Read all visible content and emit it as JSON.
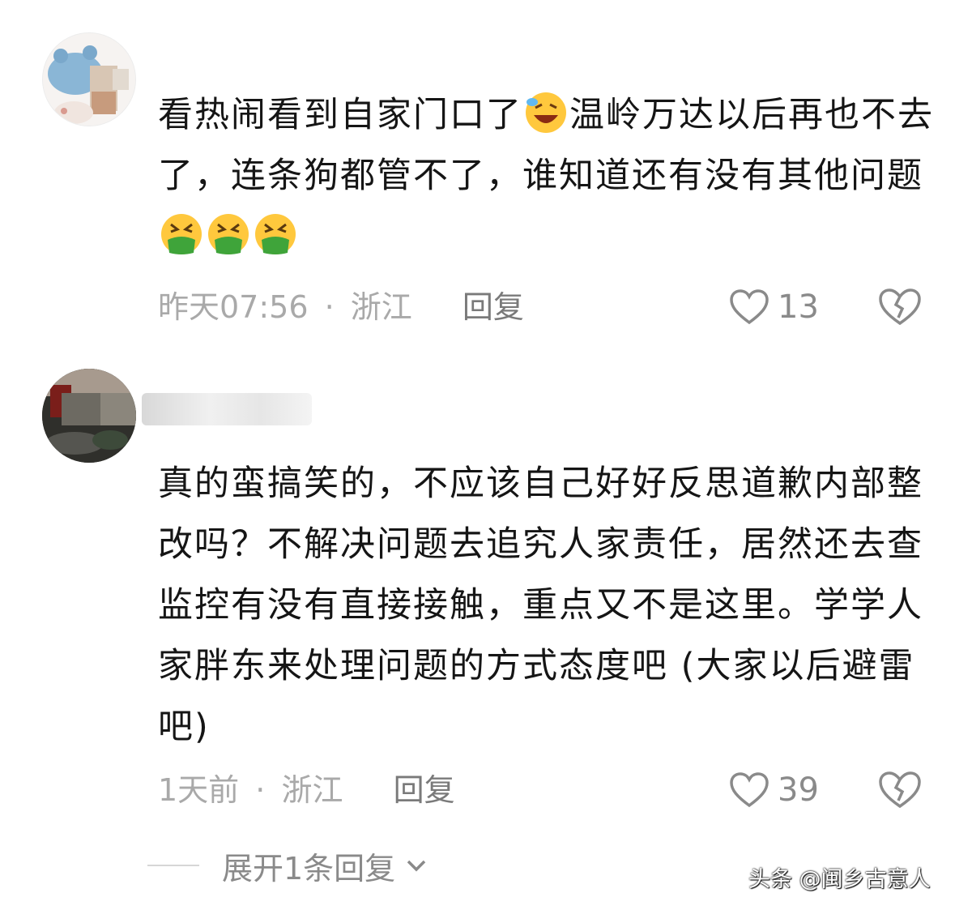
{
  "comments": [
    {
      "text_before": "看热闹看到自家门口了",
      "text_after": "温岭万达以后再也不去了，连条狗都管不了，谁知道还有没有其他问题",
      "emojis": [
        "grin-sweat-emoji",
        "nauseated-emoji",
        "nauseated-emoji",
        "nauseated-emoji"
      ],
      "time": "昨天07:56",
      "separator": "·",
      "location": "浙江",
      "reply_label": "回复",
      "like_count": "13"
    },
    {
      "text": "真的蛮搞笑的，不应该自己好好反思道歉内部整改吗？不解决问题去追究人家责任，居然还去查监控有没有直接接触，重点又不是这里。学学人家胖东来处理问题的方式态度吧 (大家以后避雷吧)",
      "time": "1天前",
      "separator": "·",
      "location": "浙江",
      "reply_label": "回复",
      "like_count": "39"
    }
  ],
  "expand_replies": {
    "label": "展开1条回复"
  },
  "watermark": "头条 @闽乡古意人",
  "colors": {
    "meta_gray": "#a9a9a9",
    "icon_gray": "#8a8a8a",
    "text": "#151515"
  }
}
